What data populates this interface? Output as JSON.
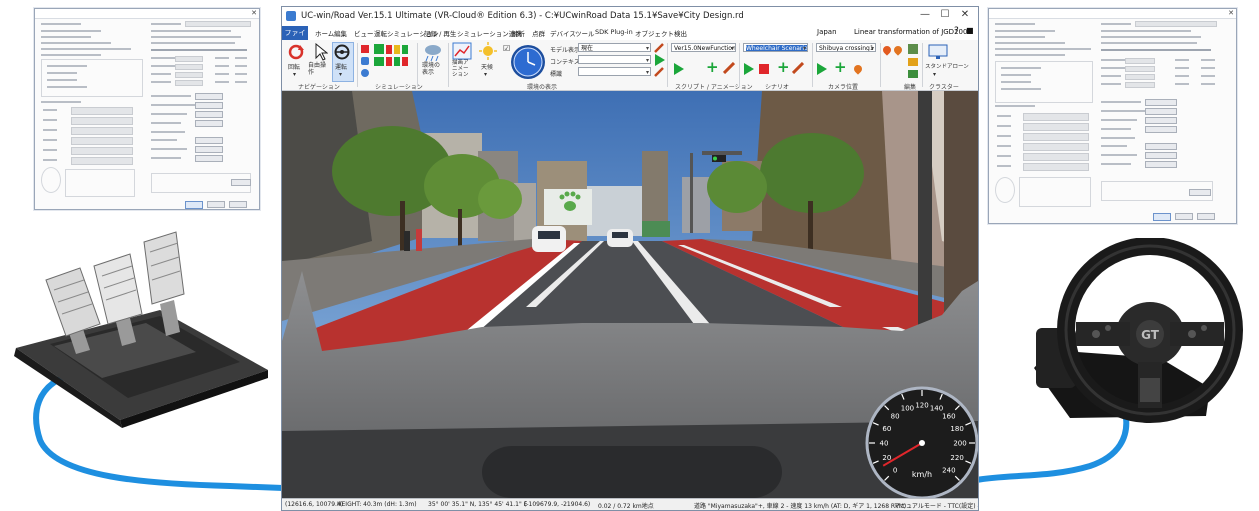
{
  "window": {
    "title": "UC-win/Road Ver.15.1 Ultimate (VR-Cloud® Edition 6.3) - C:¥UCwinRoad Data 15.1¥Save¥City Design.rd",
    "minimize": "—",
    "maximize": "☐",
    "close": "✕"
  },
  "menu": {
    "file": "ファイル",
    "items": [
      "ホーム",
      "編集",
      "ビュー",
      "運転シミュレーション",
      "記録 / 再生",
      "シミュレーション連携",
      "解析",
      "点群",
      "デバイス",
      "ツール",
      "SDK Plug-in",
      "オブジェクト検出"
    ],
    "region": "Japan",
    "transform": "Linear transformation of JGD2000"
  },
  "ribbon": {
    "rotate": "回転",
    "free": "自由操\n作",
    "drive": "運転",
    "env_display": "環境の\n表示",
    "draw_anim": "描画ア\nニメー\nション",
    "weather": "天候",
    "model_display_label": "モデル表示",
    "model_display_value": "現在",
    "context_label": "コンテキスト",
    "context_value": "",
    "marker_label": "標識",
    "marker_value": "",
    "script_value": "Ver15.0NewFunction",
    "scenario_value": "Wheelchair Scenario",
    "camera_value": "Shibuya crossing1",
    "standalone": "スタンドアローン",
    "groups": {
      "navigation": "ナビゲーション",
      "simulation": "シミュレーション",
      "env_display": "環境の表示",
      "script_anim": "スクリプト / アニメーション",
      "scenario": "シナリオ",
      "camera": "カメラ位置",
      "edit": "編集",
      "cluster": "クラスター"
    }
  },
  "speedometer": {
    "unit": "km/h",
    "ticks": [
      "0",
      "20",
      "40",
      "60",
      "80",
      "100",
      "120",
      "140",
      "160",
      "180",
      "200",
      "220",
      "240"
    ],
    "speed_kmh": 13
  },
  "status": {
    "coords": "(12616.6, 10079.4)",
    "height": "HEIGHT: 40.3m (dH: 1.3m)",
    "latlon": "35° 00' 35.1\" N, 135° 45' 41.1\" E",
    "xy": "(-109679.9, -21904.6)",
    "distance": "0.02 / 0.72 km地点",
    "road": "道路 \"Miyamasuzaka\"+, 車線 2 - 速度 13 km/h (AT: D, ギア 1, 1268 RPM)",
    "mode": "マニュアルモード - TTC(設定) --- s -"
  },
  "colors": {
    "cable": "#1e8fe0",
    "red_lane": "#b8322f",
    "file_menu": "#2b62b7"
  }
}
